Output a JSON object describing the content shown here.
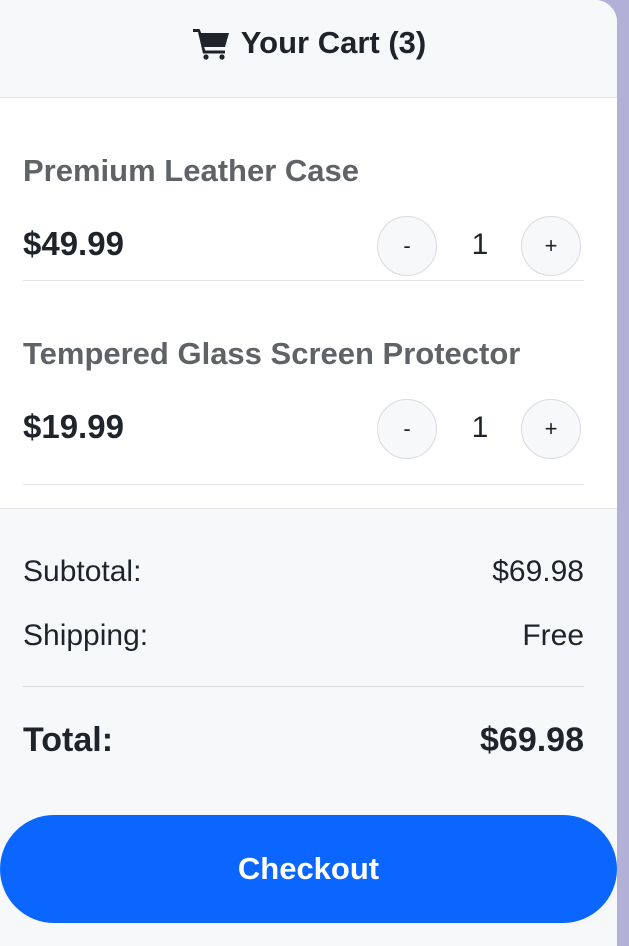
{
  "header": {
    "icon": "shopping-cart-icon",
    "title": "Your Cart (3)"
  },
  "items": [
    {
      "name": "Premium Leather Case",
      "price": "$49.99",
      "quantity": "1",
      "decrement_label": "-",
      "increment_label": "+"
    },
    {
      "name": "Tempered Glass Screen Protector",
      "price": "$19.99",
      "quantity": "1",
      "decrement_label": "-",
      "increment_label": "+"
    }
  ],
  "summary": {
    "subtotal_label": "Subtotal:",
    "subtotal_value": "$69.98",
    "shipping_label": "Shipping:",
    "shipping_value": "Free",
    "total_label": "Total:",
    "total_value": "$69.98"
  },
  "checkout_label": "Checkout",
  "colors": {
    "accent": "#0a66ff",
    "backdrop": "#b2b0d6"
  }
}
